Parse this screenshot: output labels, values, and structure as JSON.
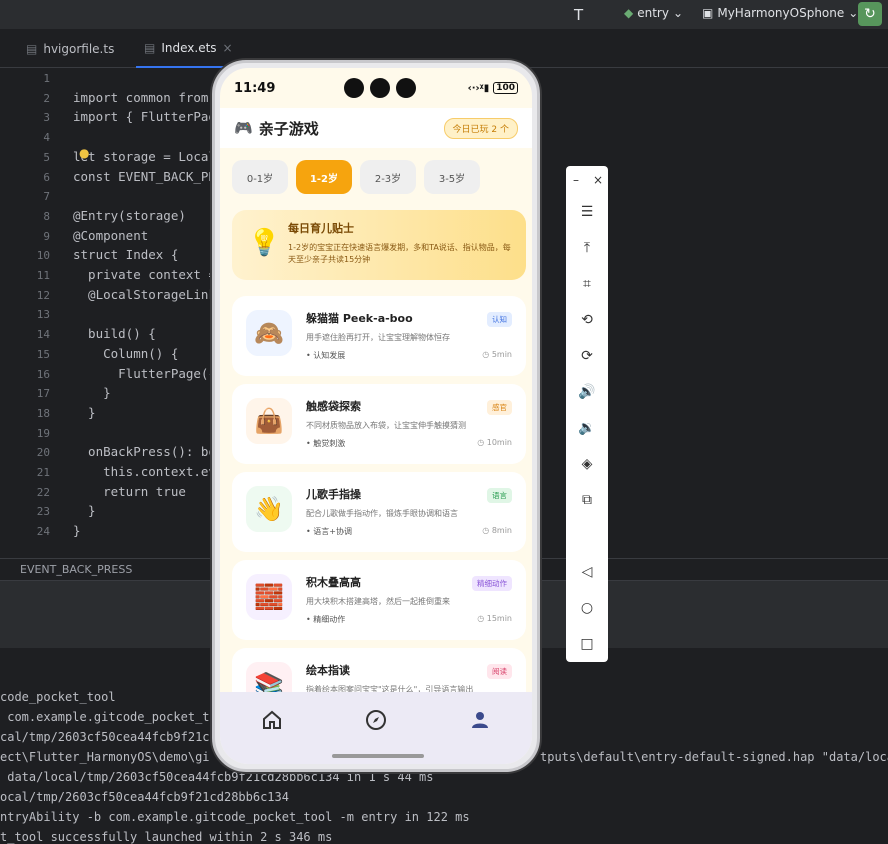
{
  "topbar": {
    "module": "entry",
    "device": "MyHarmonyOSphone"
  },
  "tabs": [
    {
      "label": "hvigorfile.ts"
    },
    {
      "label": "Index.ets"
    }
  ],
  "editor": {
    "line_numbers": [
      "1",
      "2",
      "3",
      "4",
      "5",
      "6",
      "7",
      "8",
      "9",
      "10",
      "11",
      "12",
      "13",
      "14",
      "15",
      "16",
      "17",
      "18",
      "19",
      "20",
      "21",
      "22",
      "23",
      "24"
    ],
    "lines": [
      "",
      "import common from",
      "import { FlutterPag",
      "",
      "let storage = Local",
      "const EVENT_BACK_PR",
      "",
      "@Entry(storage)",
      "@Component",
      "struct Index {",
      "  private context =",
      "  @LocalStorageLink",
      "",
      "  build() {",
      "    Column() {",
      "      FlutterPage({",
      "    }",
      "  }",
      "",
      "  onBackPress(): bo",
      "    this.context.ev",
      "    return true",
      "  }",
      "}"
    ]
  },
  "breadcrumb": "EVENT_BACK_PRESS",
  "terminal": [
    "code_pocket_tool",
    " com.example.gitcode_pocket_t",
    "cal/tmp/2603cf50cea44fcb9f21c",
    "ect\\Flutter_HarmonyOS\\demo\\gi",
    " data/local/tmp/2603cf50cea44fcb9f21cd28bb6c134 in 1 s 44 ms",
    "ocal/tmp/2603cf50cea44fcb9f21cd28bb6c134",
    "ntryAbility -b com.example.gitcode_pocket_tool -m entry in 122 ms",
    "t_tool successfully launched within 2 s 346 ms"
  ],
  "terminal_tail": "tputs\\default\\entry-default-signed.hap \"data/local",
  "phone": {
    "time": "11:49",
    "battery": "100",
    "app_title": "亲子游戏",
    "played_badge": "今日已玩 2 个",
    "age_tabs": [
      "0-1岁",
      "1-2岁",
      "2-3岁",
      "3-5岁"
    ],
    "selected_age": "1-2岁",
    "tip": {
      "title": "每日育儿贴士",
      "body": "1-2岁的宝宝正在快速语言爆发期，多和TA说话、指认物品，每天至少亲子共读15分钟"
    },
    "games": [
      {
        "title": "躲猫猫 Peek-a-boo",
        "desc": "用手遮住脸再打开，让宝宝理解物体恒存",
        "tag": "认知发展",
        "time": "5min",
        "badge": "认知",
        "icon": "🙈",
        "bg": "#eef4ff",
        "badge_bg": "#e3edff",
        "badge_color": "#3d6fe0"
      },
      {
        "title": "触感袋探索",
        "desc": "不同材质物品放入布袋，让宝宝伸手触摸猜测",
        "tag": "触觉刺激",
        "time": "10min",
        "badge": "感官",
        "icon": "👜",
        "bg": "#fff5ea",
        "badge_bg": "#fff0da",
        "badge_color": "#d98414"
      },
      {
        "title": "儿歌手指操",
        "desc": "配合儿歌做手指动作，锻炼手眼协调和语言",
        "tag": "语言+协调",
        "time": "8min",
        "badge": "语言",
        "icon": "👋",
        "bg": "#eefaf1",
        "badge_bg": "#e0f6e6",
        "badge_color": "#2a9d52"
      },
      {
        "title": "积木叠高高",
        "desc": "用大块积木搭建高塔，然后一起推倒重来",
        "tag": "精细动作",
        "time": "15min",
        "badge": "精细动作",
        "icon": "🧱",
        "bg": "#f6f0ff",
        "badge_bg": "#efe5ff",
        "badge_color": "#8a56d8"
      },
      {
        "title": "绘本指读",
        "desc": "指着绘本图案问宝宝\"这是什么\"，引导语言输出",
        "tag": "",
        "time": "",
        "badge": "阅读",
        "icon": "📚",
        "bg": "#fff0f3",
        "badge_bg": "#ffe6ec",
        "badge_color": "#d8436b"
      }
    ]
  },
  "colors": {
    "accent": "#f6a40e",
    "ide_bg": "#1e1f22",
    "ide_tab_active": "#3574f0"
  }
}
